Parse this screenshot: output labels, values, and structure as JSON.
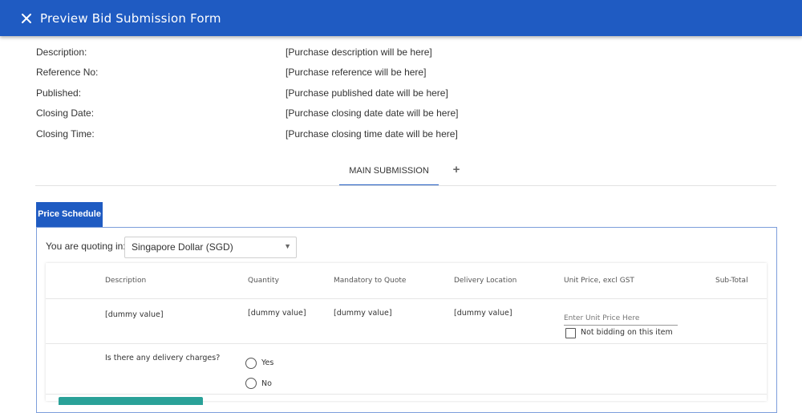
{
  "header": {
    "title": "Preview Bid Submission Form",
    "close_icon": "close-icon"
  },
  "info": [
    {
      "label": "Description:",
      "value": "[Purchase description will be here]"
    },
    {
      "label": "Reference No:",
      "value": "[Purchase reference will be here]"
    },
    {
      "label": "Published:",
      "value": "[Purchase published date will be here]"
    },
    {
      "label": "Closing Date:",
      "value": "[Purchase closing date date will be here]"
    },
    {
      "label": "Closing Time:",
      "value": "[Purchase closing time date will be here]"
    }
  ],
  "tabs": {
    "main": "MAIN SUBMISSION",
    "add_icon": "+"
  },
  "section": {
    "title": "Price Schedule"
  },
  "quote": {
    "label": "You are quoting in:",
    "currency": "Singapore Dollar (SGD)"
  },
  "table": {
    "headers": [
      "Description",
      "Quantity",
      "Mandatory to Quote",
      "Delivery Location",
      "Unit Price, excl GST",
      "Sub-Total"
    ],
    "row": {
      "description": "[dummy value]",
      "quantity": "[dummy value]",
      "mandatory": "[dummy value]",
      "location": "[dummy value]",
      "unit_price_placeholder": "Enter Unit Price Here",
      "not_bidding_label": "Not bidding on this item"
    }
  },
  "delivery": {
    "question": "Is there any delivery charges?",
    "options": [
      "Yes",
      "No"
    ]
  },
  "colors": {
    "header_bg": "#1f5bc2",
    "accent": "#1f5bc2",
    "teal": "#2aa198"
  }
}
